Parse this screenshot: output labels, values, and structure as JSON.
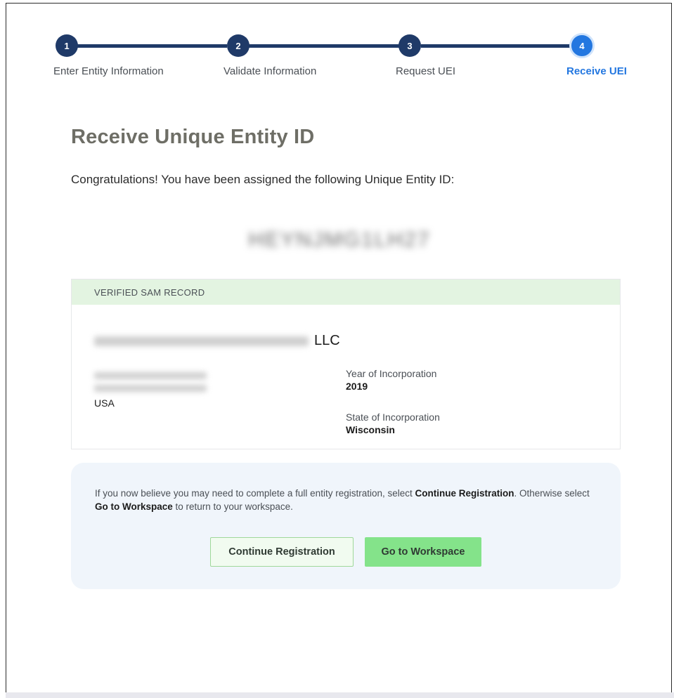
{
  "stepper": {
    "steps": [
      {
        "number": "1",
        "label": "Enter Entity Information",
        "state": "completed"
      },
      {
        "number": "2",
        "label": "Validate Information",
        "state": "completed"
      },
      {
        "number": "3",
        "label": "Request UEI",
        "state": "completed"
      },
      {
        "number": "4",
        "label": "Receive UEI",
        "state": "current"
      }
    ],
    "colors": {
      "completed": "#1f3a68",
      "current": "#2377e0"
    }
  },
  "main": {
    "title": "Receive Unique Entity ID",
    "congrats_text": "Congratulations! You have been assigned the following Unique Entity ID:",
    "uei_value": "HEYNJMG1LH27"
  },
  "record": {
    "header": "VERIFIED SAM RECORD",
    "entity_suffix": "LLC",
    "country": "USA",
    "year_label": "Year of Incorporation",
    "year_value": "2019",
    "state_label": "State of Incorporation",
    "state_value": "Wisconsin"
  },
  "actions": {
    "text_part1": "If you now believe you may need to complete a full entity registration, select ",
    "text_bold1": "Continue Registration",
    "text_part2": ". Otherwise select ",
    "text_bold2": "Go to Workspace",
    "text_part3": " to return to your workspace.",
    "continue_label": "Continue Registration",
    "workspace_label": "Go to Workspace"
  }
}
